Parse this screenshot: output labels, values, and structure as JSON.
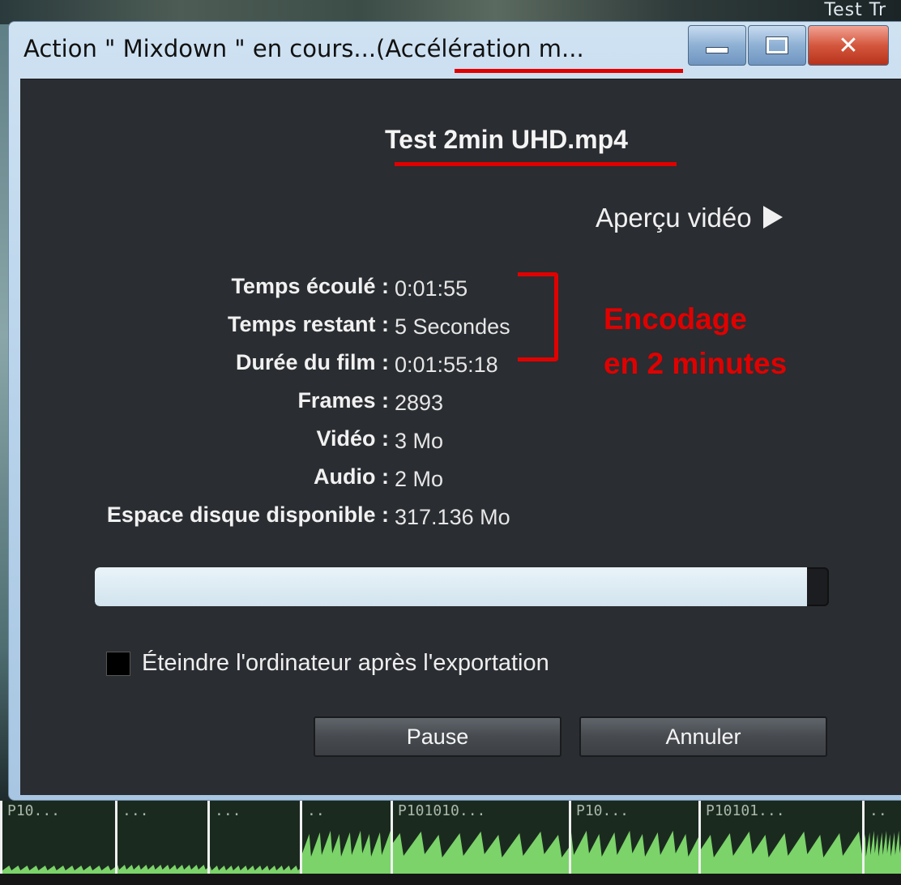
{
  "background": {
    "partial_title": "Test Tr"
  },
  "window": {
    "title": "Action \" Mixdown \" en cours...(Accélération m...",
    "filename": "Test 2min UHD.mp4",
    "preview_label": "Aperçu vidéo",
    "stats": [
      {
        "label": "Temps écoulé :",
        "value": "0:01:55"
      },
      {
        "label": "Temps restant :",
        "value": "5 Secondes"
      },
      {
        "label": "Durée du film :",
        "value": "0:01:55:18"
      },
      {
        "label": "Frames :",
        "value": "2893"
      },
      {
        "label": "Vidéo :",
        "value": "3 Mo"
      },
      {
        "label": "Audio :",
        "value": "2 Mo"
      },
      {
        "label": "Espace disque disponible :",
        "value": "317.136 Mo"
      }
    ],
    "progress": 0.97,
    "shutdown_label": "Éteindre l'ordinateur après l'exportation",
    "shutdown_checked": false,
    "pause_label": "Pause",
    "cancel_label": "Annuler"
  },
  "annotation": {
    "line1": "Encodage",
    "line2": "en 2 minutes",
    "color": "#e00000"
  },
  "timeline": {
    "clips": [
      "P10...",
      "...",
      "...",
      "..",
      "P101010...",
      "P10...",
      "P10101...",
      ".."
    ]
  },
  "colors": {
    "client_bg": "#2a2d31",
    "accent_red": "#e00000",
    "progress_fill": "#e9f3f9",
    "waveform": "#7bd36a"
  }
}
